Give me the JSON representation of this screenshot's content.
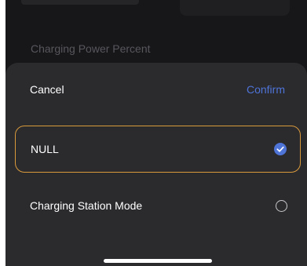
{
  "background": {
    "setting_label": "Charging Power Percent"
  },
  "sheet": {
    "cancel_label": "Cancel",
    "confirm_label": "Confirm",
    "options": [
      {
        "label": "NULL",
        "selected": true
      },
      {
        "label": "Charging Station Mode",
        "selected": false
      }
    ]
  },
  "colors": {
    "accent": "#4f74d8",
    "selection_border": "#d99a3c",
    "sheet_background": "#2b2b2e",
    "page_background": "#17171a"
  }
}
